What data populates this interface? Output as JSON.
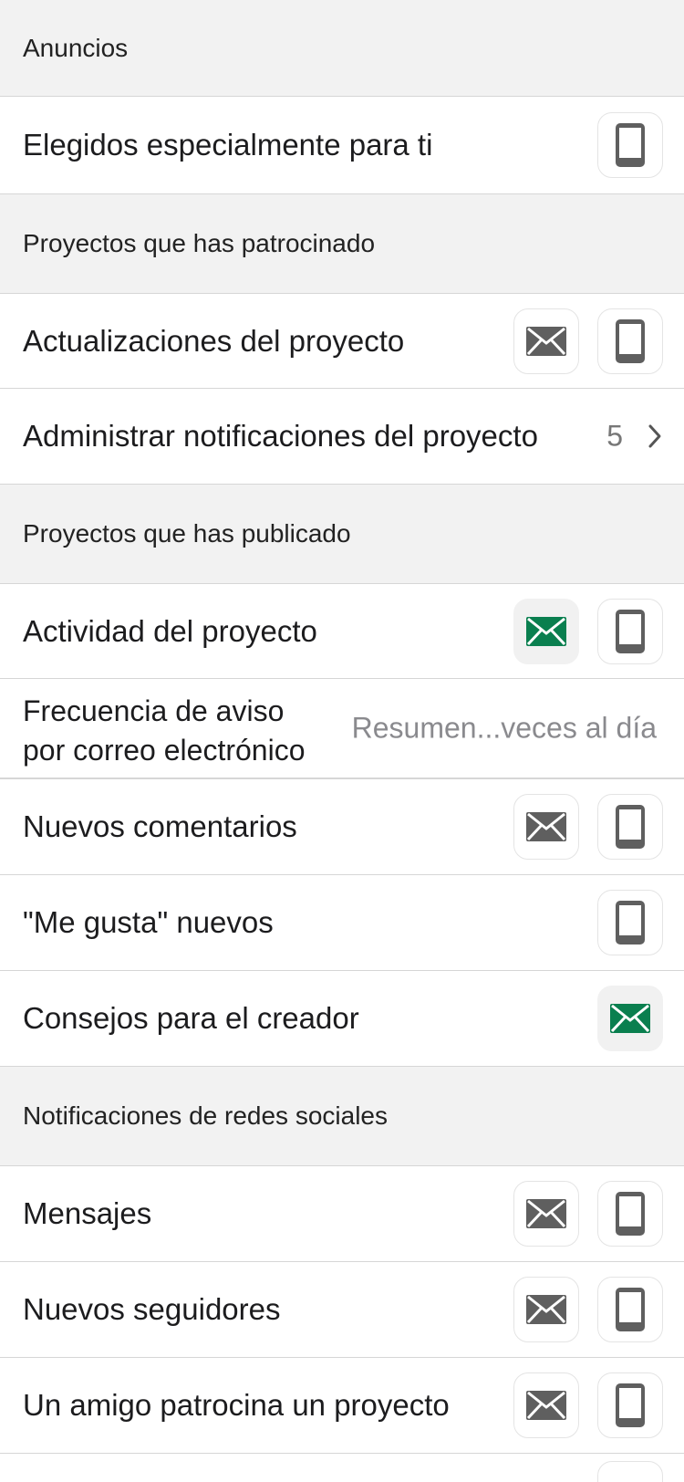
{
  "sections": {
    "anuncios": "Anuncios",
    "patrocinado": "Proyectos que has patrocinado",
    "publicado": "Proyectos que has publicado",
    "redes": "Notificaciones de redes sociales"
  },
  "rows": {
    "elegidos": "Elegidos especialmente para ti",
    "actualizaciones": "Actualizaciones del proyecto",
    "administrar": "Administrar notificaciones del proyecto",
    "administrar_count": "5",
    "actividad": "Actividad del proyecto",
    "frecuencia_line1": "Frecuencia de aviso",
    "frecuencia_line2": "por correo electrónico",
    "frecuencia_value": "Resumen...veces al día",
    "comentarios": "Nuevos comentarios",
    "megusta": "\"Me gusta\" nuevos",
    "consejos": "Consejos para el creador",
    "mensajes": "Mensajes",
    "seguidores": "Nuevos seguidores",
    "amigo": "Un amigo patrocina un proyecto"
  },
  "icons": {
    "mail": "envelope-icon",
    "phone": "phone-icon",
    "chevron": "chevron-right-icon"
  },
  "colors": {
    "mail_on": "#0a7f4f",
    "mail_off": "#5f5f5f",
    "phone": "#5f5f5f",
    "section_bg": "#f2f2f2"
  },
  "toggles": {
    "actividad_mail": "on",
    "consejos_mail": "on"
  }
}
